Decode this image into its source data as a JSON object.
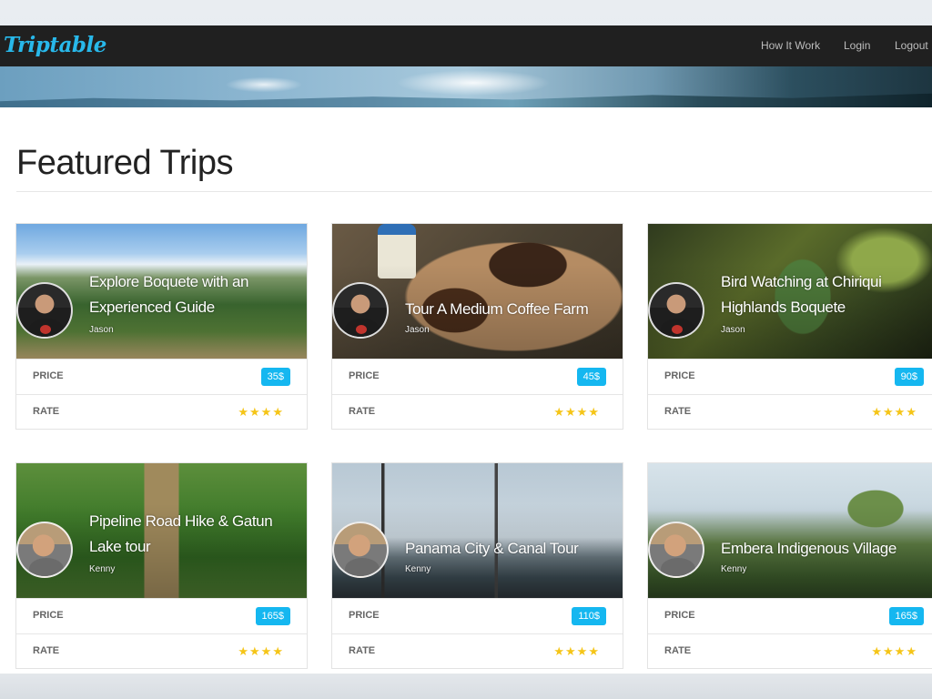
{
  "navbar": {
    "brand": "Triptable",
    "links": [
      "How It Work",
      "Login",
      "Logout"
    ]
  },
  "page": {
    "title": "Featured Trips"
  },
  "labels": {
    "price": "PRICE",
    "rate": "RATE"
  },
  "trips": [
    {
      "title": "Explore Boquete with an Experienced Guide",
      "author": "Jason",
      "price": "35$",
      "rating": 4,
      "stars": "★★★★"
    },
    {
      "title": "Tour A Medium Coffee Farm",
      "author": "Jason",
      "price": "45$",
      "rating": 4,
      "stars": "★★★★"
    },
    {
      "title": "Bird Watching at Chiriqui Highlands Boquete",
      "author": "Jason",
      "price": "90$",
      "rating": 4,
      "stars": "★★★★"
    },
    {
      "title": "Pipeline Road Hike & Gatun Lake tour",
      "author": "Kenny",
      "price": "165$",
      "rating": 4,
      "stars": "★★★★"
    },
    {
      "title": "Panama City & Canal Tour",
      "author": "Kenny",
      "price": "110$",
      "rating": 4,
      "stars": "★★★★"
    },
    {
      "title": "Embera Indigenous Village",
      "author": "Kenny",
      "price": "165$",
      "rating": 4,
      "stars": "★★★★"
    }
  ],
  "colors": {
    "brand": "#28b8ea",
    "badge": "#15b7f0",
    "star": "#f5c518",
    "navbar": "#202020"
  }
}
